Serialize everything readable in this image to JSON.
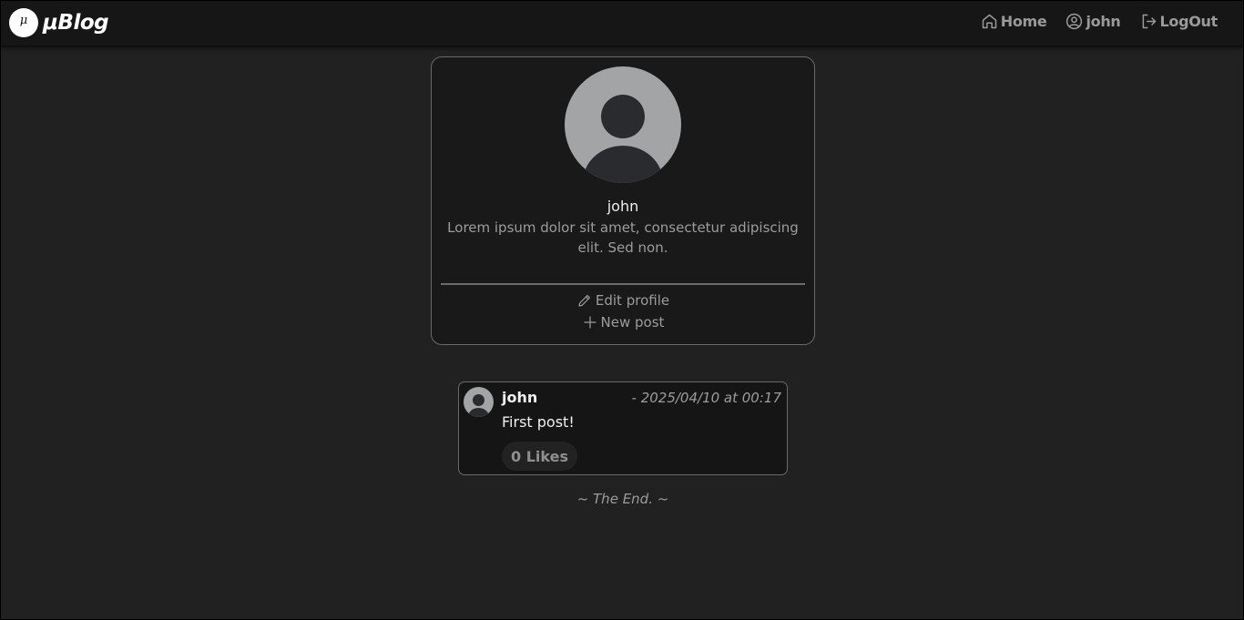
{
  "navbar": {
    "logo_glyph": "μ",
    "brand": "μBlog",
    "links": {
      "home": "Home",
      "user": "john",
      "logout": "LogOut"
    }
  },
  "profile": {
    "name": "john",
    "bio": "Lorem ipsum dolor sit amet, consectetur adipiscing elit. Sed non.",
    "edit_label": "Edit profile",
    "new_post_label": "New post"
  },
  "posts": [
    {
      "author": "john",
      "date": "- 2025/04/10 at 00:17",
      "text": "First post!",
      "likes": "0 Likes"
    }
  ],
  "footer": {
    "end_text": "~ The End. ~"
  },
  "colors": {
    "background": "#212121",
    "navbar": "#161616",
    "card": "#191919",
    "muted_text": "#9c9c9c",
    "avatar": "#a3a4a6"
  }
}
